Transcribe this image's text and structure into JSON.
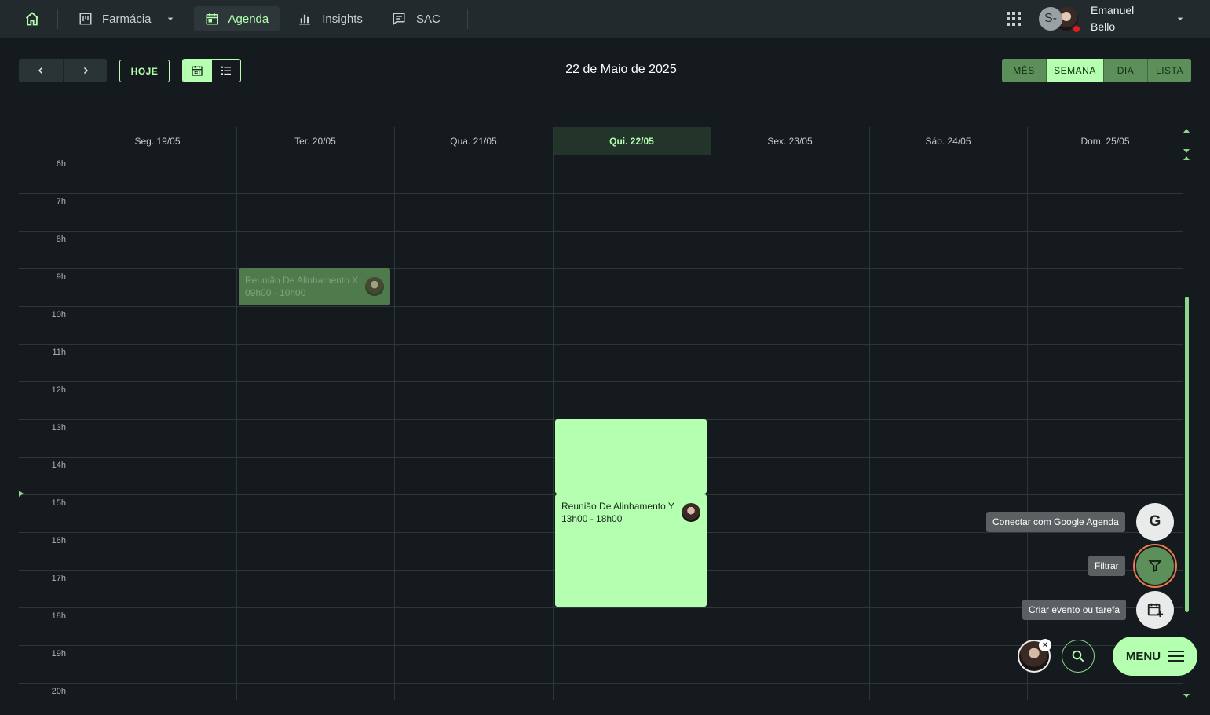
{
  "topbar": {
    "items": [
      {
        "label": "Farmácia",
        "icon": "kanban-icon",
        "active": false
      },
      {
        "label": "Agenda",
        "icon": "calendar-icon",
        "active": true
      },
      {
        "label": "Insights",
        "icon": "bar-chart-icon",
        "active": false
      },
      {
        "label": "SAC",
        "icon": "chat-icon",
        "active": false
      }
    ],
    "avatar_initial": "S-",
    "user_first": "Emanuel",
    "user_last": "Bello"
  },
  "toolbar": {
    "today_label": "HOJE",
    "date_title": "22 de Maio de 2025",
    "ranges": [
      {
        "label": "MÊS",
        "selected": false
      },
      {
        "label": "SEMANA",
        "selected": true
      },
      {
        "label": "DIA",
        "selected": false
      },
      {
        "label": "LISTA",
        "selected": false
      }
    ]
  },
  "calendar": {
    "days": [
      {
        "label": "Seg. 19/05",
        "today": false
      },
      {
        "label": "Ter. 20/05",
        "today": false
      },
      {
        "label": "Qua. 21/05",
        "today": false
      },
      {
        "label": "Qui. 22/05",
        "today": true
      },
      {
        "label": "Sex. 23/05",
        "today": false
      },
      {
        "label": "Sáb. 24/05",
        "today": false
      },
      {
        "label": "Dom. 25/05",
        "today": false
      }
    ],
    "hours": [
      "6h",
      "7h",
      "8h",
      "9h",
      "10h",
      "11h",
      "12h",
      "13h",
      "14h",
      "15h",
      "16h",
      "17h",
      "18h",
      "19h",
      "20h"
    ],
    "events": [
      {
        "title": "Reunião De Alinhamento X",
        "time": "09h00 - 10h00",
        "day": 1,
        "start": 9,
        "end": 10
      },
      {
        "title": "Reunião De Alinhamento Y",
        "time": "13h00 - 18h00",
        "day": 3,
        "start": 13,
        "end": 18
      }
    ]
  },
  "fabs": {
    "google_tip": "Conectar com Google Agenda",
    "google_letter": "G",
    "filter_tip": "Filtrar",
    "create_tip": "Criar evento ou tarefa",
    "menu_label": "MENU",
    "close_glyph": "×"
  },
  "colors": {
    "accent": "#b4ffb0",
    "accent_dark": "#5d8f5b",
    "background": "#141a1d",
    "topbar": "#222a2d"
  }
}
